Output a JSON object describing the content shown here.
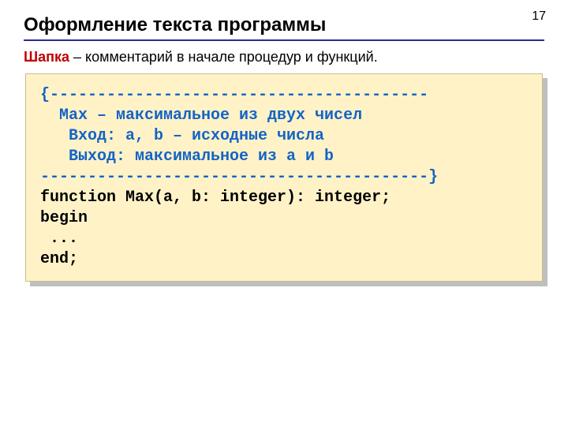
{
  "page_number": "17",
  "title": "Оформление текста программы",
  "subtitle_key": "Шапка",
  "subtitle_rest": " – комментарий в начале процедур и функций.",
  "code": {
    "c1": "{----------------------------------------",
    "c2": "  Max – максимальное из двух чисел",
    "c3": "   Вход: a, b – исходные числа",
    "c4": "   Выход: максимальное из a и b",
    "c5": "-----------------------------------------}",
    "l1a": "function",
    "l1b": " Max(a, b: integer): integer;",
    "l2": "begin",
    "l3": " ...",
    "l4": "end;"
  }
}
